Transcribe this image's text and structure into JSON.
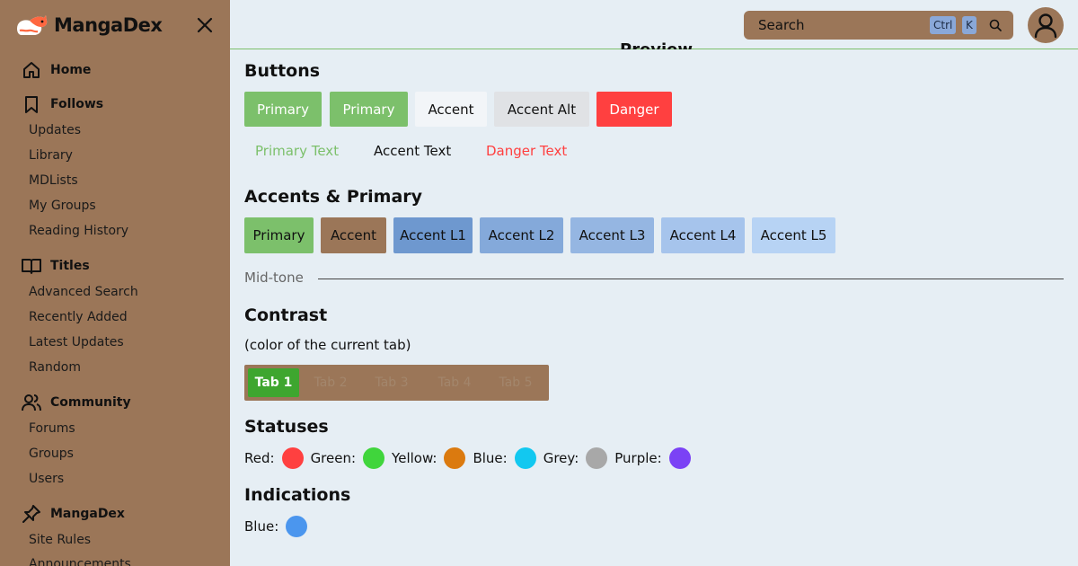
{
  "brand": {
    "name": "MangaDex"
  },
  "sidebar": {
    "home": "Home",
    "follows": {
      "label": "Follows",
      "items": [
        "Updates",
        "Library",
        "MDLists",
        "My Groups",
        "Reading History"
      ]
    },
    "titles": {
      "label": "Titles",
      "items": [
        "Advanced Search",
        "Recently Added",
        "Latest Updates",
        "Random"
      ]
    },
    "community": {
      "label": "Community",
      "items": [
        "Forums",
        "Groups",
        "Users"
      ]
    },
    "mangadex": {
      "label": "MangaDex",
      "items": [
        "Site Rules",
        "Announcements"
      ]
    }
  },
  "topbar": {
    "search_placeholder": "Search",
    "shortcut_ctrl": "Ctrl",
    "shortcut_k": "K",
    "preview_heading": "Preview"
  },
  "main": {
    "buttons_heading": "Buttons",
    "buttons": [
      "Primary",
      "Primary",
      "Accent",
      "Accent Alt",
      "Danger"
    ],
    "text_buttons": [
      "Primary Text",
      "Accent Text",
      "Danger Text"
    ],
    "accents_heading": "Accents & Primary",
    "swatches": [
      "Primary",
      "Accent",
      "Accent L1",
      "Accent L2",
      "Accent L3",
      "Accent L4",
      "Accent L5"
    ],
    "midtone_label": "Mid-tone",
    "contrast_heading": "Contrast",
    "contrast_sub": "(color of the current tab)",
    "tabs": [
      "Tab 1",
      "Tab 2",
      "Tab 3",
      "Tab 4",
      "Tab 5"
    ],
    "statuses_heading": "Statuses",
    "statuses": [
      {
        "label": "Red:",
        "color": "#ff4040"
      },
      {
        "label": "Green:",
        "color": "#40d53c"
      },
      {
        "label": "Yellow:",
        "color": "#db7a0f"
      },
      {
        "label": "Blue:",
        "color": "#12c8f0"
      },
      {
        "label": "Grey:",
        "color": "#a8a8a8"
      },
      {
        "label": "Purple:",
        "color": "#7b42f5"
      }
    ],
    "indications_heading": "Indications",
    "indications": [
      {
        "label": "Blue:",
        "color": "#4b96ee"
      }
    ]
  },
  "colors": {
    "sidebar": "#9b7658",
    "background": "#e6eef4",
    "primary": "#7cc06b",
    "accent": "#9b7658",
    "accent_alt": "#e0e2e5",
    "danger": "#ff4040",
    "accent_l1": "#6e98cf",
    "accent_l2": "#84a9da",
    "accent_l3": "#95b6e2",
    "accent_l4": "#a6c4ec",
    "accent_l5": "#b7d3f4",
    "tab_active": "#3ea62f"
  }
}
